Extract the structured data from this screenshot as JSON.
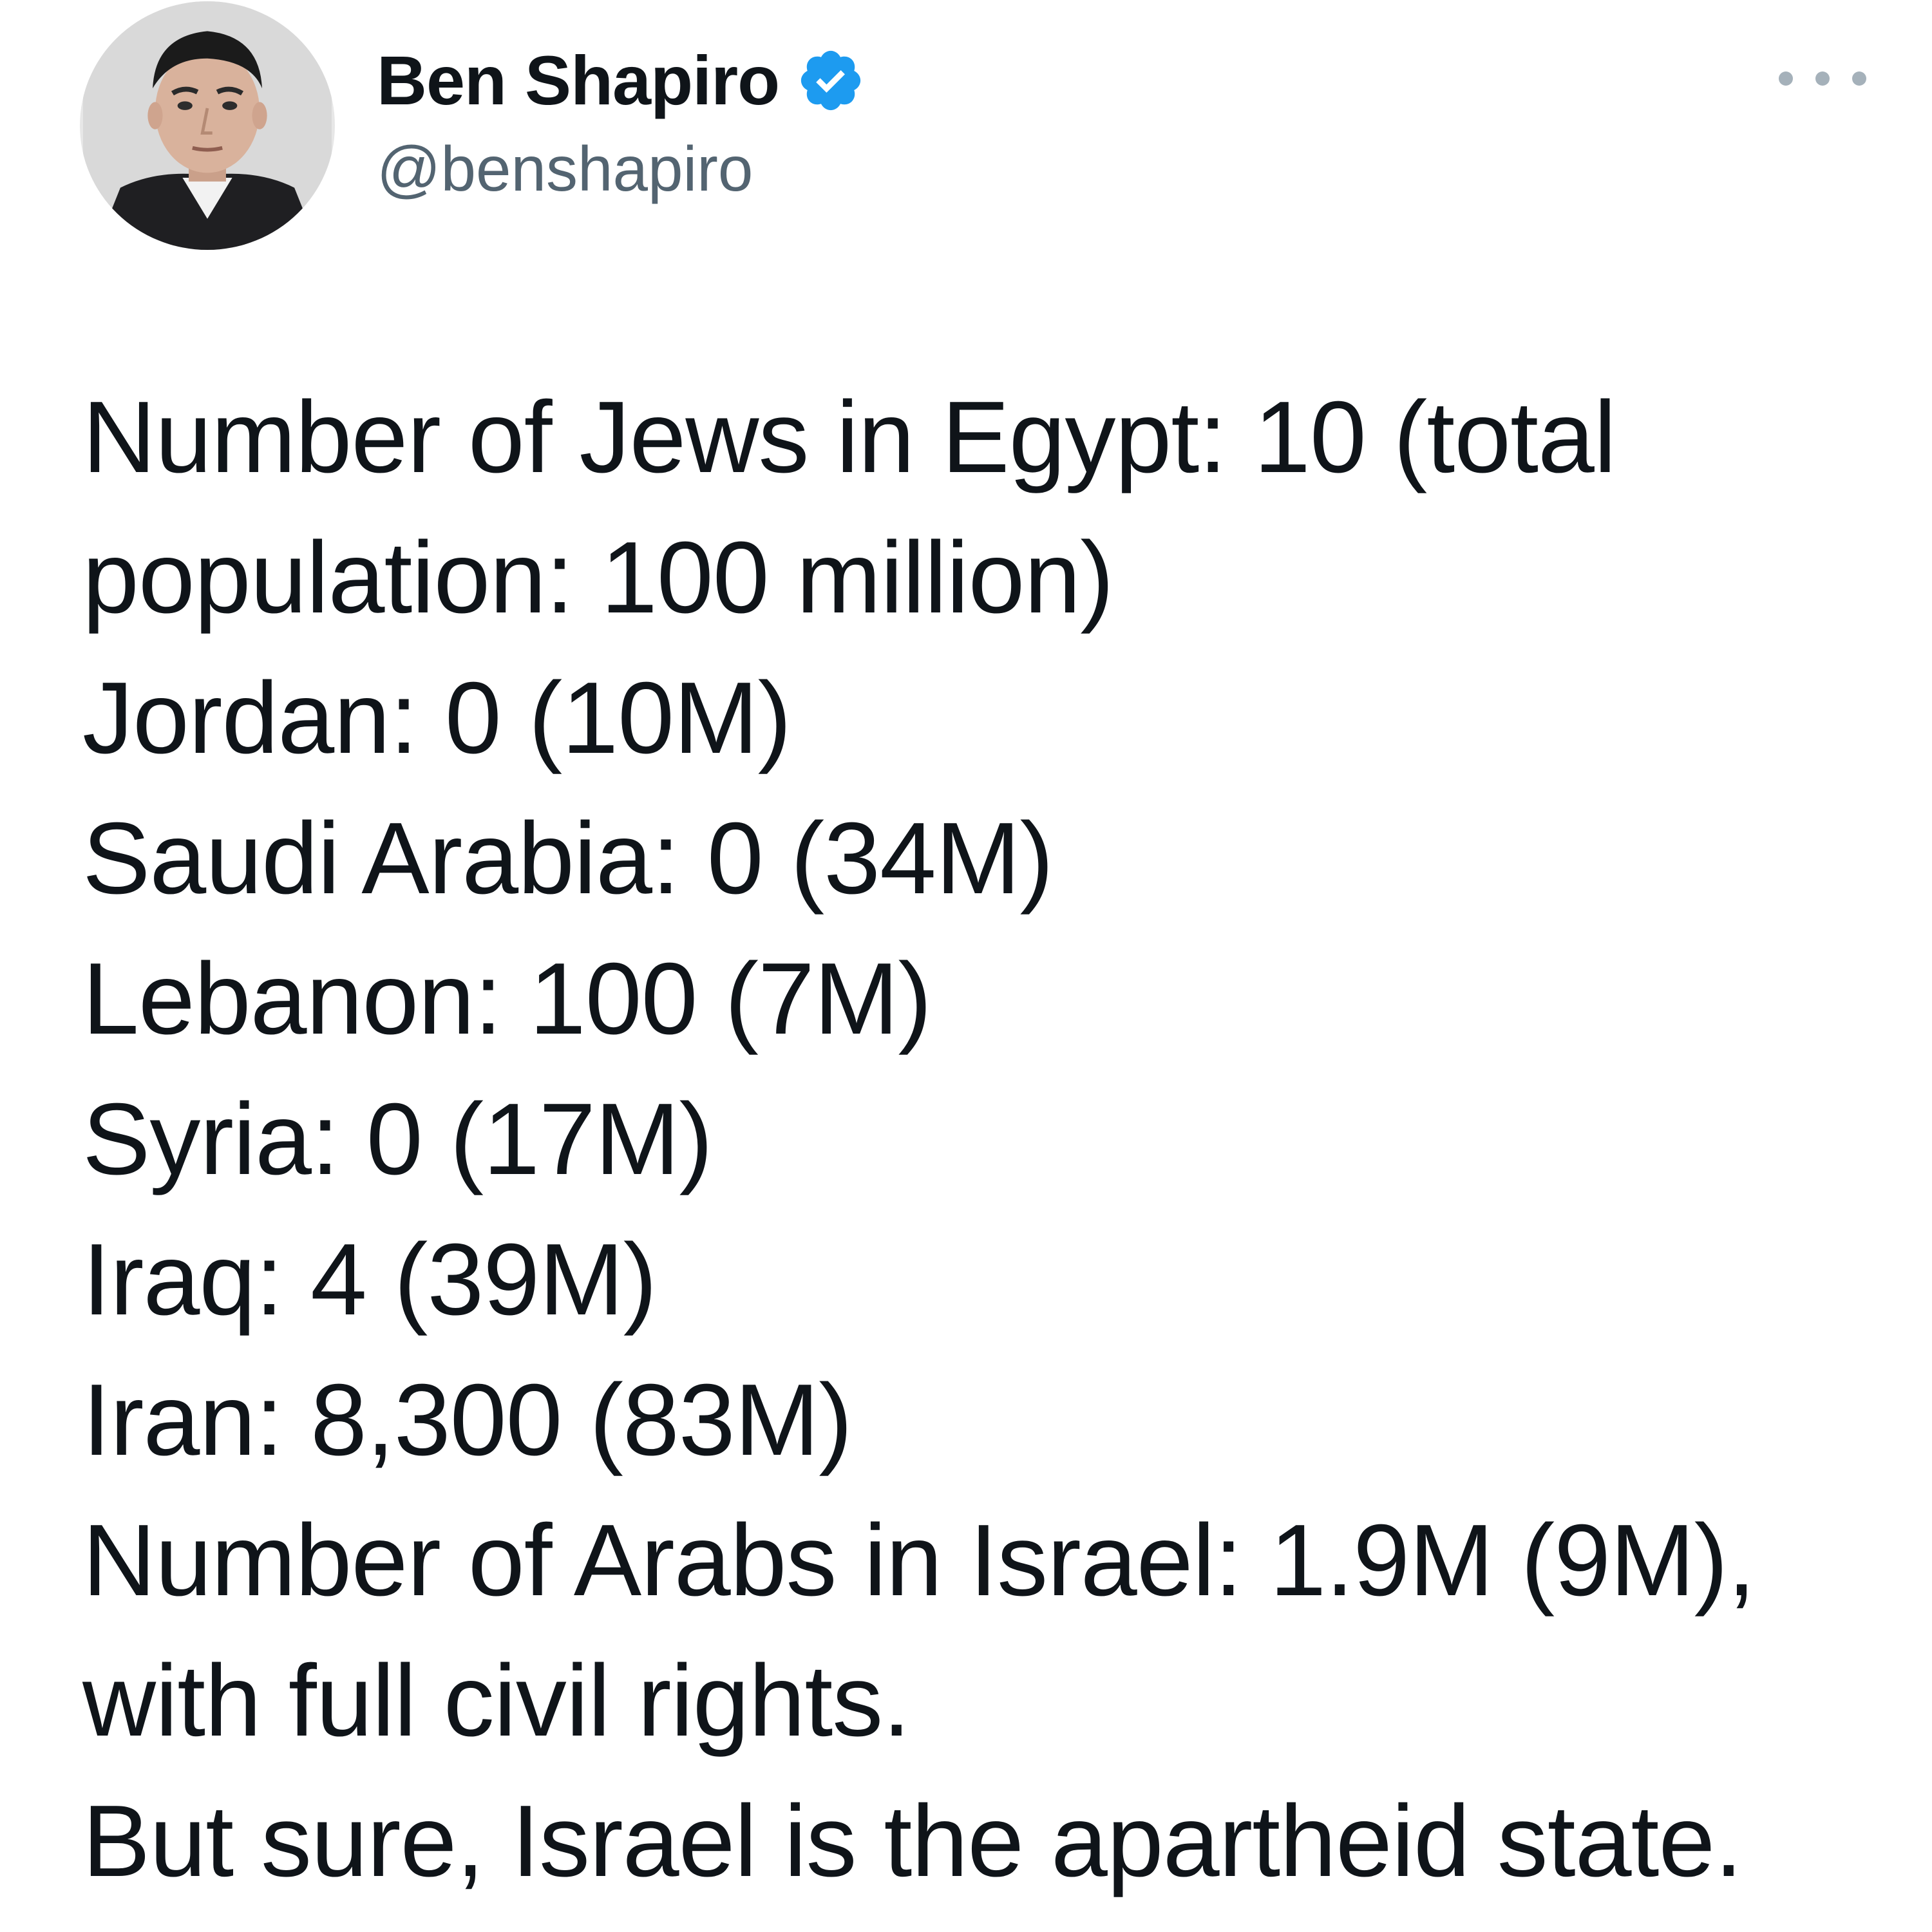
{
  "author": {
    "display_name": "Ben Shapiro",
    "handle": "@benshapiro",
    "verified": true,
    "verified_badge_color": "#1d9bf0"
  },
  "icons": {
    "verified": "verified-badge-icon",
    "more": "more-options-icon"
  },
  "tweet": {
    "lines": [
      "Number of Jews in Egypt: 10 (total",
      "population: 100 million)",
      "Jordan: 0 (10M)",
      "Saudi Arabia: 0 (34M)",
      "Lebanon: 100 (7M)",
      "Syria: 0 (17M)",
      "Iraq: 4 (39M)",
      "Iran: 8,300 (83M)",
      "Number of Arabs in Israel: 1.9M (9M),",
      "with full civil rights.",
      "But sure, Israel is the apartheid state."
    ]
  },
  "colors": {
    "text": "#0f1419",
    "secondary_text": "#536471",
    "background": "#ffffff"
  }
}
